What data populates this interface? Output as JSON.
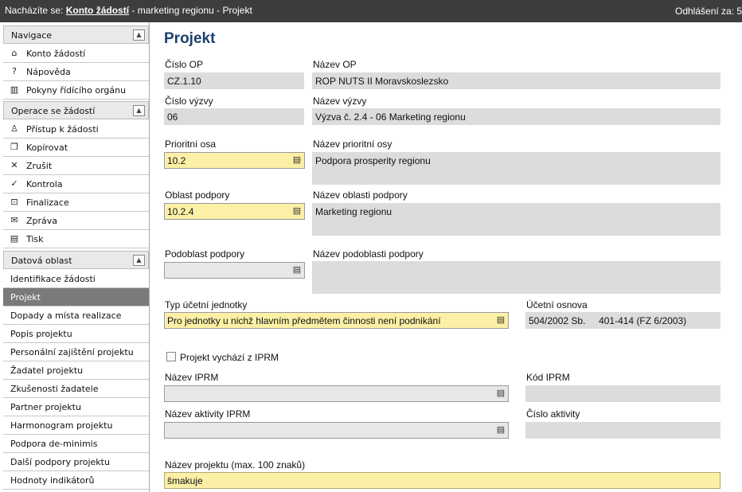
{
  "topbar": {
    "prefix": "Nacházíte se:",
    "link": "Konto žádostí",
    "rest": "- marketing regionu - Projekt",
    "logout": "Odhlášení za: 5"
  },
  "sidebar": {
    "sections": [
      {
        "title": "Navigace",
        "toggle": "▲",
        "items": [
          {
            "icon": "⌂",
            "label": "Konto žádostí"
          },
          {
            "icon": "?",
            "label": "Nápověda"
          },
          {
            "icon": "▥",
            "label": "Pokyny řídícího orgánu"
          }
        ]
      },
      {
        "title": "Operace se žádostí",
        "toggle": "▲",
        "items": [
          {
            "icon": "♙",
            "label": "Přístup k žádosti"
          },
          {
            "icon": "❐",
            "label": "Kopírovat"
          },
          {
            "icon": "✕",
            "label": "Zrušit"
          },
          {
            "icon": "✓",
            "label": "Kontrola"
          },
          {
            "icon": "⊡",
            "label": "Finalizace"
          },
          {
            "icon": "✉",
            "label": "Zpráva"
          },
          {
            "icon": "▤",
            "label": "Tisk"
          }
        ]
      },
      {
        "title": "Datová oblast",
        "toggle": "▲",
        "items": [
          {
            "label": "Identifikace žádosti"
          },
          {
            "label": "Projekt"
          },
          {
            "label": "Dopady a místa realizace"
          },
          {
            "label": "Popis projektu"
          },
          {
            "label": "Personální zajištění projektu"
          },
          {
            "label": "Žadatel projektu"
          },
          {
            "label": "Zkušenosti žadatele"
          },
          {
            "label": "Partner projektu"
          },
          {
            "label": "Harmonogram projektu"
          },
          {
            "label": "Podpora de-minimis"
          },
          {
            "label": "Další podpory projektu"
          },
          {
            "label": "Hodnoty indikátorů"
          }
        ]
      }
    ]
  },
  "main": {
    "title": "Projekt",
    "fields": {
      "cislo_op": {
        "label": "Číslo OP",
        "value": "CZ.1.10"
      },
      "nazev_op": {
        "label": "Název OP",
        "value": "ROP NUTS II Moravskoslezsko"
      },
      "cislo_vyzvy": {
        "label": "Číslo výzvy",
        "value": "06"
      },
      "nazev_vyzvy": {
        "label": "Název výzvy",
        "value": "Výzva č. 2.4 - 06 Marketing regionu"
      },
      "prioritni_osa": {
        "label": "Prioritní osa",
        "value": "10.2"
      },
      "nazev_prioritni_osy": {
        "label": "Název prioritní osy",
        "value": "Podpora prosperity regionu"
      },
      "oblast_podpory": {
        "label": "Oblast podpory",
        "value": "10.2.4"
      },
      "nazev_oblasti_podpory": {
        "label": "Název oblasti podpory",
        "value": "Marketing regionu"
      },
      "podoblast_podpory": {
        "label": "Podoblast podpory",
        "value": ""
      },
      "nazev_podoblasti_podpory": {
        "label": "Název podoblasti podpory",
        "value": ""
      },
      "typ_ucetni_jednotky": {
        "label": "Typ účetní jednotky",
        "value": "Pro jednotky u nichž hlavním předmětem činnosti není podnikání"
      },
      "ucetni_osnova": {
        "label": "Účetní osnova",
        "value": "504/2002 Sb.     401-414 (FZ 6/2003)"
      },
      "projekt_iprm": {
        "label": "Projekt vychází z IPRM",
        "checked": false
      },
      "nazev_iprm": {
        "label": "Název IPRM",
        "value": ""
      },
      "kod_iprm": {
        "label": "Kód IPRM",
        "value": ""
      },
      "nazev_aktivity_iprm": {
        "label": "Název aktivity IPRM",
        "value": ""
      },
      "cislo_aktivity": {
        "label": "Číslo aktivity",
        "value": ""
      },
      "nazev_projektu": {
        "label": "Název projektu (max. 100 znaků)",
        "value": "šmakuje"
      }
    },
    "select_icon": "▤"
  }
}
